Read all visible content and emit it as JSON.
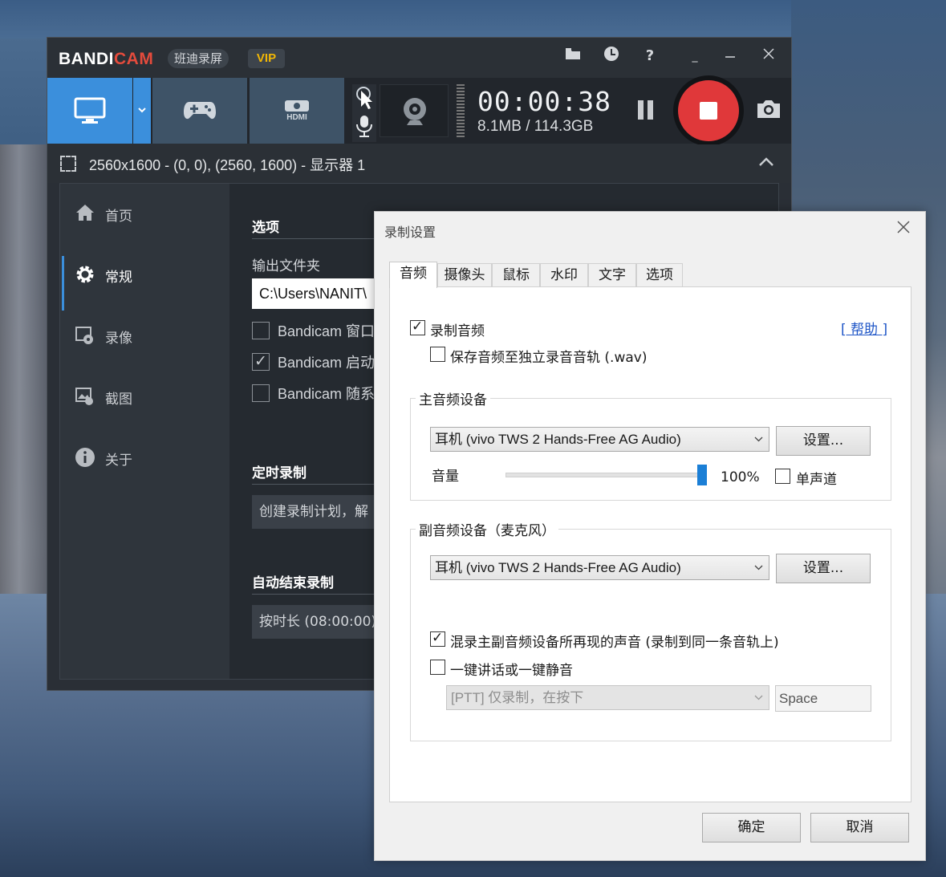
{
  "bandicam": {
    "logo_main": "BANDI",
    "logo_accent": "CAM",
    "logo_cn": "班迪录屏",
    "vip": "VIP",
    "timer": "00:00:38",
    "file_size": "8.1MB / 114.3GB",
    "hdmi_label": "HDMI",
    "area_text": "2560x1600 - (0, 0), (2560, 1600) - 显示器 1",
    "sidebar": [
      {
        "label": "首页",
        "icon": "home-icon"
      },
      {
        "label": "常规",
        "icon": "gear-icon"
      },
      {
        "label": "录像",
        "icon": "video-icon"
      },
      {
        "label": "截图",
        "icon": "image-icon"
      },
      {
        "label": "关于",
        "icon": "info-icon"
      }
    ],
    "options_title": "选项",
    "output_folder_label": "输出文件夹",
    "output_folder_value": "C:\\Users\\NANIT\\",
    "checkboxes": [
      {
        "label": "Bandicam 窗口",
        "checked": false
      },
      {
        "label": "Bandicam 启动",
        "checked": true
      },
      {
        "label": "Bandicam 随系",
        "checked": false
      }
    ],
    "schedule_title": "定时录制",
    "schedule_value": "创建录制计划，解",
    "autostop_title": "自动结束录制",
    "autostop_value": "按时长 (08:00:00)"
  },
  "dialog": {
    "title": "录制设置",
    "tabs": [
      "音频",
      "摄像头",
      "鼠标",
      "水印",
      "文字",
      "选项"
    ],
    "active_tab": "音频",
    "record_audio_label": "录制音频",
    "record_audio_checked": true,
    "help_label": "[ 帮助 ]",
    "separate_track_label": "保存音频至独立录音音轨 (.wav)",
    "separate_track_checked": false,
    "primary_group_title": "主音频设备",
    "primary_device": "耳机 (vivo TWS 2 Hands-Free AG Audio)",
    "settings_button": "设置...",
    "volume_label": "音量",
    "volume_value": "100%",
    "volume_level": 1.0,
    "mono_label": "单声道",
    "mono_checked": false,
    "secondary_group_title": "副音频设备（麦克风）",
    "secondary_device": "耳机 (vivo TWS 2 Hands-Free AG Audio)",
    "mix_label": "混录主副音频设备所再现的声音 (录制到同一条音轨上)",
    "mix_checked": true,
    "ptt_label": "一键讲话或一键静音",
    "ptt_checked": false,
    "ptt_mode": "[PTT] 仅录制，在按下",
    "ptt_key": "Space",
    "ok_button": "确定",
    "cancel_button": "取消"
  },
  "colors": {
    "accent_blue": "#3b8fdc",
    "record_red": "#e0383a",
    "vip_gold": "#f2b705",
    "slider_blue": "#1b7fd6"
  }
}
